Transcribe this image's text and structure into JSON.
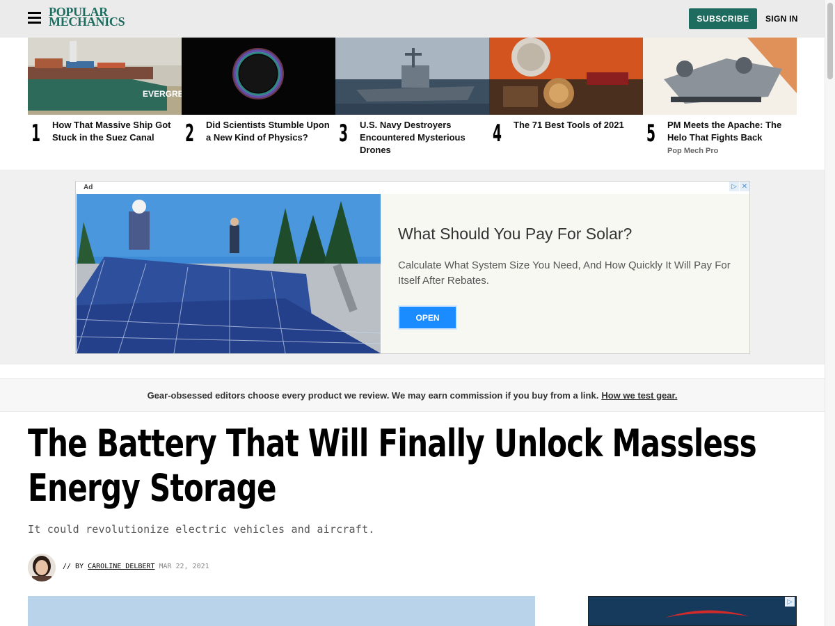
{
  "header": {
    "logo_line1": "POPULAR",
    "logo_line2": "MECHANICS",
    "subscribe_label": "SUBSCRIBE",
    "signin_label": "SIGN IN"
  },
  "trending": [
    {
      "num": "1",
      "title": "How That Massive Ship Got Stuck in the Suez Canal",
      "sub": ""
    },
    {
      "num": "2",
      "title": "Did Scientists Stumble Upon a New Kind of Physics?",
      "sub": ""
    },
    {
      "num": "3",
      "title": "U.S. Navy Destroyers Encountered Mysterious Drones",
      "sub": ""
    },
    {
      "num": "4",
      "title": "The 71 Best Tools of 2021",
      "sub": ""
    },
    {
      "num": "5",
      "title": "PM Meets the Apache: The Helo That Fights Back",
      "sub": "Pop Mech Pro"
    }
  ],
  "ad": {
    "label": "Ad",
    "headline": "What Should You Pay For Solar?",
    "body": "Calculate What System Size You Need, And How Quickly It Will Pay For Itself After Rebates.",
    "button": "OPEN"
  },
  "disclaimer": {
    "text": "Gear-obsessed editors choose every product we review. We may earn commission if you buy from a link.",
    "link": "How we test gear."
  },
  "article": {
    "headline_line1": "The Battery That Will Finally Unlock Massless",
    "headline_line2": "Energy Storage",
    "dek": "It could revolutionize electric vehicles and aircraft.",
    "byline_prefix": "// BY",
    "author": "CAROLINE DELBERT",
    "date": "MAR 22, 2021"
  },
  "colors": {
    "brand": "#1e6b5f",
    "ad_button": "#1a8cff"
  }
}
